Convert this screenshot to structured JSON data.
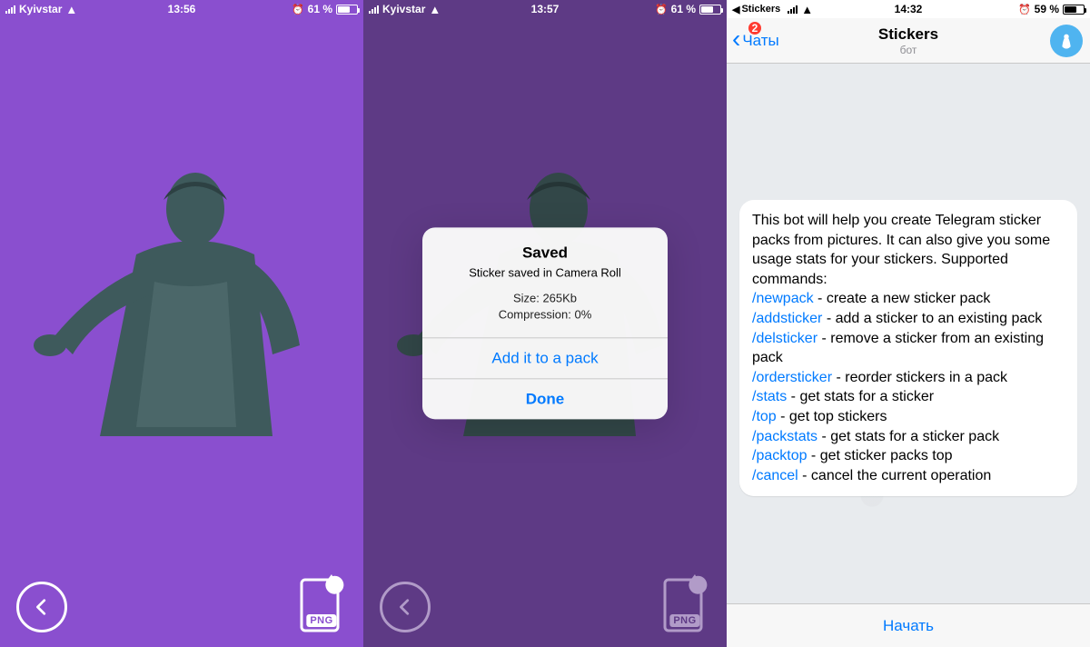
{
  "panel1": {
    "status": {
      "carrier": "Kyivstar",
      "time": "13:56",
      "battery_pct": "61 %",
      "battery_fill": 61
    },
    "png_label": "PNG"
  },
  "panel2": {
    "status": {
      "carrier": "Kyivstar",
      "time": "13:57",
      "battery_pct": "61 %",
      "battery_fill": 61
    },
    "png_label": "PNG",
    "alert": {
      "title": "Saved",
      "message": "Sticker saved in Camera Roll",
      "size_line": "Size: 265Kb",
      "compression_line": "Compression: 0%",
      "action_add": "Add it to a pack",
      "action_done": "Done"
    }
  },
  "panel3": {
    "status": {
      "breadcrumb": "Stickers",
      "time": "14:32",
      "battery_pct": "59 %",
      "battery_fill": 59
    },
    "nav": {
      "back_label": "Чаты",
      "badge": "2",
      "title": "Stickers",
      "subtitle": "бот"
    },
    "message": {
      "intro": "This bot will help you create Telegram sticker packs from pictures. It can also give you some usage stats for your stickers. Supported commands:",
      "commands": [
        {
          "cmd": "/newpack",
          "desc": " - create a new sticker pack"
        },
        {
          "cmd": "/addsticker",
          "desc": " - add a sticker to an existing pack"
        },
        {
          "cmd": "/delsticker",
          "desc": " - remove a sticker from an existing pack"
        },
        {
          "cmd": "/ordersticker",
          "desc": " - reorder stickers in a pack"
        },
        {
          "cmd": "/stats",
          "desc": " - get stats for a sticker"
        },
        {
          "cmd": "/top",
          "desc": " - get top stickers"
        },
        {
          "cmd": "/packstats",
          "desc": " - get stats for a sticker pack"
        },
        {
          "cmd": "/packtop",
          "desc": " - get sticker packs top"
        },
        {
          "cmd": "/cancel",
          "desc": " - cancel the current operation"
        }
      ]
    },
    "footer": {
      "start_label": "Начать"
    }
  }
}
